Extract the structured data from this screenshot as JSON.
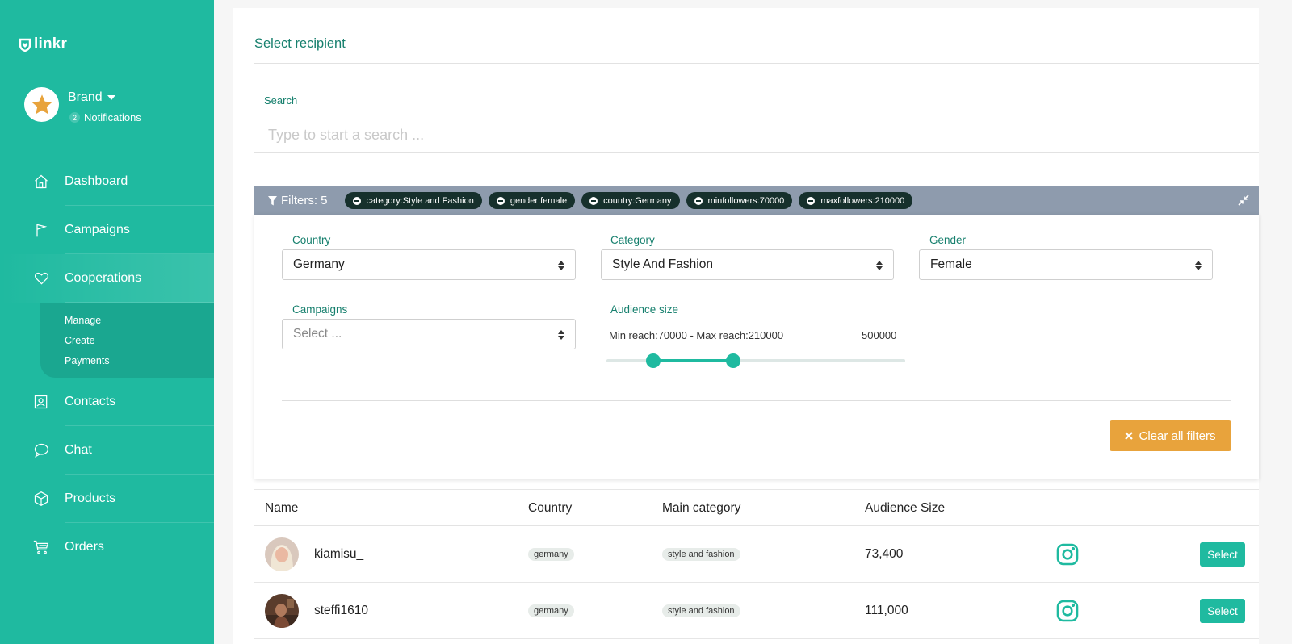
{
  "sidebar": {
    "logo_text": "linkr",
    "profile": {
      "name": "Brand",
      "notification_count": "2",
      "notifications_label": "Notifications"
    },
    "nav": [
      {
        "label": "Dashboard",
        "icon": "home-icon"
      },
      {
        "label": "Campaigns",
        "icon": "flag-icon"
      },
      {
        "label": "Cooperations",
        "icon": "heart-icon"
      },
      {
        "label": "Contacts",
        "icon": "contact-card-icon"
      },
      {
        "label": "Chat",
        "icon": "chat-bubble-icon"
      },
      {
        "label": "Products",
        "icon": "box-icon"
      },
      {
        "label": "Orders",
        "icon": "cart-icon"
      }
    ],
    "submenu": [
      "Manage",
      "Create",
      "Payments"
    ]
  },
  "main": {
    "title": "Select recipient",
    "search": {
      "label": "Search",
      "placeholder": "Type to start a search ..."
    },
    "filters": {
      "title": "Filters: 5",
      "chips": [
        "category:Style and Fashion",
        "gender:female",
        "country:Germany",
        "minfollowers:70000",
        "maxfollowers:210000"
      ],
      "country": {
        "label": "Country",
        "value": "Germany"
      },
      "category": {
        "label": "Category",
        "value": "Style And Fashion"
      },
      "gender": {
        "label": "Gender",
        "value": "Female"
      },
      "campaigns": {
        "label": "Campaigns",
        "placeholder": "Select ..."
      },
      "audience": {
        "label": "Audience size",
        "range_text": "Min reach:70000 - Max reach:210000",
        "max_text": "500000",
        "min_value": 70000,
        "max_value": 210000,
        "scale_max": 500000
      },
      "clear_label": "Clear all filters"
    },
    "table": {
      "headers": {
        "name": "Name",
        "country": "Country",
        "category": "Main category",
        "audience": "Audience Size"
      },
      "rows": [
        {
          "name": "kiamisu_",
          "country": "germany",
          "category": "style and fashion",
          "audience": "73,400",
          "action": "Select"
        },
        {
          "name": "steffi1610",
          "country": "germany",
          "category": "style and fashion",
          "audience": "111,000",
          "action": "Select"
        }
      ]
    }
  },
  "colors": {
    "primary": "#1fbaa0",
    "accent": "#e8a33c",
    "filterbar": "#8e9bad",
    "chip": "#16302c"
  }
}
